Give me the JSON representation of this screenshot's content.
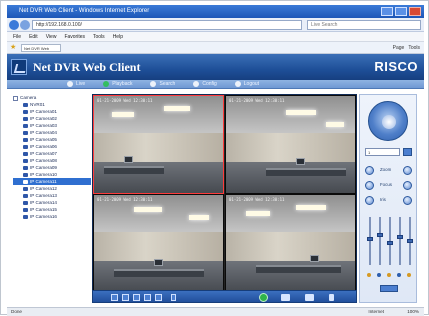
{
  "browser": {
    "title": "Net DVR Web Client - Windows Internet Explorer",
    "address": "http://192.168.0.100/",
    "search_placeholder": "Live Search",
    "menu": [
      "File",
      "Edit",
      "View",
      "Favorites",
      "Tools",
      "Help"
    ],
    "tab_label": "Net DVR Web Client",
    "commands": [
      "Page",
      "Tools"
    ]
  },
  "app": {
    "title": "Net DVR Web Client",
    "brand": "RISCO",
    "nav": [
      "Live",
      "Playback",
      "Search",
      "Config",
      "Logout"
    ]
  },
  "tree": {
    "root": "Camera",
    "items": [
      "NVR01",
      "IP Camera01",
      "IP Camera02",
      "IP Camera03",
      "IP Camera04",
      "IP Camera05",
      "IP Camera06",
      "IP Camera07",
      "IP Camera08",
      "IP Camera09",
      "IP Camera10",
      "IP Camera11",
      "IP Camera12",
      "IP Camera13",
      "IP Camera14",
      "IP Camera15",
      "IP Camera16"
    ],
    "selected_index": 11
  },
  "video": {
    "cells": [
      {
        "osd": "01-21-2009 Wed 12:30:11"
      },
      {
        "osd": "01-21-2009 Wed 12:30:11"
      },
      {
        "osd": "01-21-2009 Wed 12:30:11"
      },
      {
        "osd": "01-21-2009 Wed 12:30:11"
      }
    ]
  },
  "ptz": {
    "preset_value": "1",
    "labels": [
      "Zoom",
      "Focus",
      "Iris"
    ]
  },
  "status": {
    "left": "Done",
    "zone": "Internet",
    "zoom": "100%"
  },
  "colors": {
    "header_blue": "#1e4f98",
    "active_tab": "#27c24c"
  }
}
